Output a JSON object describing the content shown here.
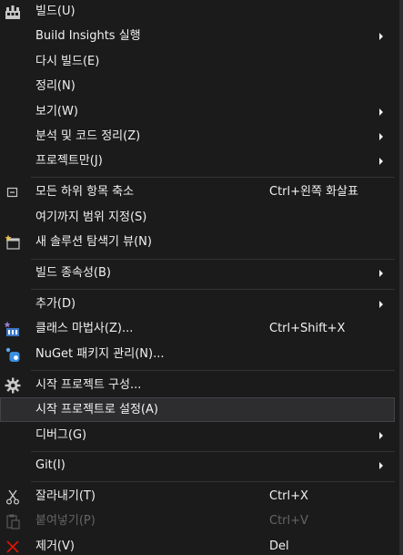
{
  "colors": {
    "menu_background": "#1b1b1c",
    "text": "#f1f1f1",
    "text_disabled": "#656565",
    "selected_background": "#2d2d30",
    "selected_border": "#434346",
    "separator": "#333337",
    "close_icon": "#e51400"
  },
  "menu": {
    "build": {
      "label": "빌드(U)",
      "icon": "build-icon"
    },
    "build_insights": {
      "label": "Build Insights 실행"
    },
    "rebuild": {
      "label": "다시 빌드(E)"
    },
    "clean": {
      "label": "정리(N)"
    },
    "view": {
      "label": "보기(W)"
    },
    "analyze": {
      "label": "분석 및 코드 정리(Z)"
    },
    "project_only": {
      "label": "프로젝트만(J)"
    },
    "collapse_all": {
      "label": "모든 하위 항목 축소",
      "shortcut": "Ctrl+왼쪽 화살표",
      "icon": "collapse-all-icon"
    },
    "scope_to_this": {
      "label": "여기까지 범위 지정(S)"
    },
    "new_solution_explorer_view": {
      "label": "새 솔루션 탐색기 뷰(N)",
      "icon": "new-solution-explorer-view-icon"
    },
    "build_dependencies": {
      "label": "빌드 종속성(B)"
    },
    "add": {
      "label": "추가(D)"
    },
    "class_wizard": {
      "label": "클래스 마법사(Z)...",
      "shortcut": "Ctrl+Shift+X",
      "icon": "class-wizard-icon"
    },
    "manage_nuget": {
      "label": "NuGet 패키지 관리(N)...",
      "icon": "nuget-icon"
    },
    "configure_startup": {
      "label": "시작 프로젝트 구성...",
      "icon": "gear-icon"
    },
    "set_as_startup": {
      "label": "시작 프로젝트로 설정(A)"
    },
    "debug": {
      "label": "디버그(G)"
    },
    "git": {
      "label": "Git(I)"
    },
    "cut": {
      "label": "잘라내기(T)",
      "shortcut": "Ctrl+X",
      "icon": "scissors-icon"
    },
    "paste": {
      "label": "붙여넣기(P)",
      "shortcut": "Ctrl+V",
      "icon": "paste-icon",
      "disabled": true
    },
    "remove": {
      "label": "제거(V)",
      "shortcut": "Del",
      "icon": "close-icon"
    }
  }
}
